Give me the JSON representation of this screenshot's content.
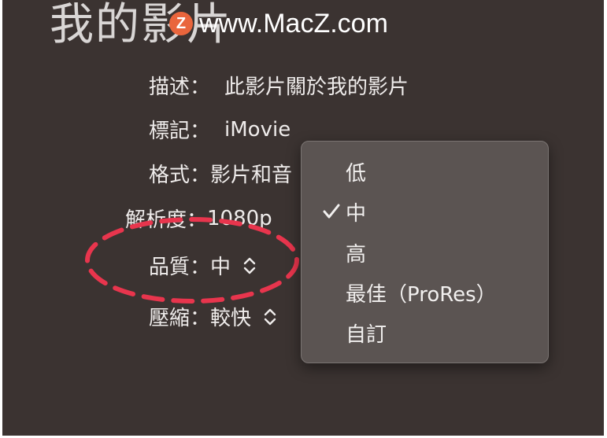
{
  "title": "我的影片",
  "watermark": {
    "logo": "Z",
    "text": "www.MacZ.com"
  },
  "fields": {
    "description": {
      "label": "描述：",
      "value": "此影片關於我的影片"
    },
    "tags": {
      "label": "標記：",
      "value": "iMovie"
    },
    "format": {
      "label": "格式：",
      "value": "影片和音"
    },
    "resolution": {
      "label": "解析度：",
      "value": "1080p"
    },
    "quality": {
      "label": "品質：",
      "value": "中"
    },
    "compression": {
      "label": "壓縮：",
      "value": "較快"
    }
  },
  "quality_menu": {
    "items": [
      {
        "label": "低",
        "checked": false
      },
      {
        "label": "中",
        "checked": true
      },
      {
        "label": "高",
        "checked": false
      },
      {
        "label": "最佳（ProRes）",
        "checked": false
      },
      {
        "label": "自訂",
        "checked": false
      }
    ]
  },
  "icons": {
    "stepper": "updown-chevron-icon",
    "check": "checkmark-icon"
  },
  "colors": {
    "background": "#3b3331",
    "menu": "#5b5452",
    "annotation": "#e8354d",
    "logo": "#e9653c"
  }
}
